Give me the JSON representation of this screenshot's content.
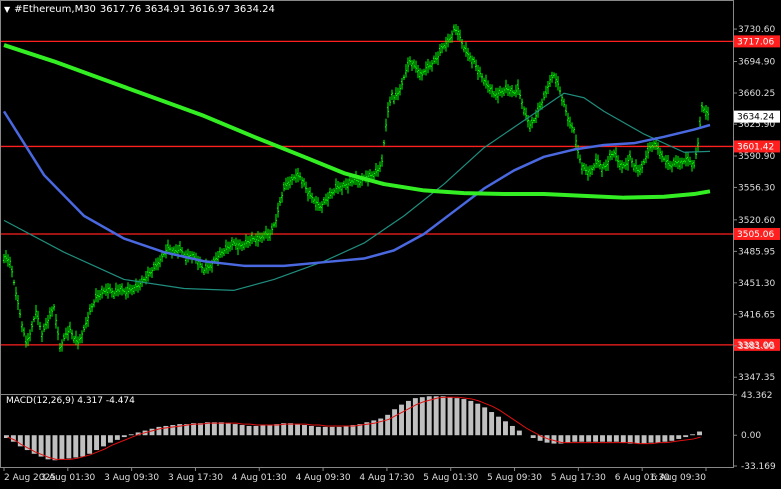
{
  "header": {
    "title": "#Ethereum,M30",
    "ohlc": "3617.76 3634.91 3616.97 3634.24"
  },
  "macd_header": {
    "label": "MACD(12,26,9)",
    "values": "4.317 -4.474"
  },
  "colors": {
    "background": "#000000",
    "candle": "#00ff00",
    "ma_fast": "#1f8e7e",
    "ma_mid": "#4a68e0",
    "ma_slow": "#33ee22",
    "hline": "#ff1f1f",
    "macd_hist": "#c0c0c0",
    "macd_signal": "#e01010",
    "price_tag_bg": "#ffffff",
    "price_tag_text": "#000000"
  },
  "chart_data": [
    {
      "type": "candlestick",
      "symbol": "#Ethereum",
      "timeframe": "M30",
      "ylim": [
        3330,
        3745
      ],
      "y_ticks": [
        "3730.60",
        "3694.90",
        "3660.25",
        "3625.90",
        "3590.90",
        "3556.30",
        "3520.60",
        "3485.95",
        "3451.30",
        "3416.65",
        "3381.95",
        "3347.35"
      ],
      "x_ticks": [
        "2 Aug 2025",
        "3 Aug 01:30",
        "3 Aug 09:30",
        "3 Aug 17:30",
        "4 Aug 01:30",
        "4 Aug 09:30",
        "4 Aug 17:30",
        "5 Aug 01:30",
        "5 Aug 09:30",
        "5 Aug 17:30",
        "6 Aug 01:30",
        "6 Aug 09:30"
      ],
      "horizontal_levels": [
        {
          "value": 3717.06,
          "label": "3717.06"
        },
        {
          "value": 3601.42,
          "label": "3601.42"
        },
        {
          "value": 3505.06,
          "label": "3505.06"
        },
        {
          "value": 3383.0,
          "label": "3383.00"
        }
      ],
      "current_price": {
        "value": 3634.24,
        "label": "3634.24"
      },
      "close_path": [
        [
          0,
          3480
        ],
        [
          6,
          3475
        ],
        [
          12,
          3440
        ],
        [
          18,
          3405
        ],
        [
          22,
          3385
        ],
        [
          26,
          3395
        ],
        [
          32,
          3420
        ],
        [
          38,
          3395
        ],
        [
          44,
          3410
        ],
        [
          50,
          3425
        ],
        [
          56,
          3380
        ],
        [
          62,
          3395
        ],
        [
          66,
          3400
        ],
        [
          70,
          3390
        ],
        [
          74,
          3385
        ],
        [
          80,
          3400
        ],
        [
          86,
          3420
        ],
        [
          92,
          3435
        ],
        [
          98,
          3440
        ],
        [
          104,
          3445
        ],
        [
          110,
          3440
        ],
        [
          116,
          3445
        ],
        [
          122,
          3440
        ],
        [
          128,
          3445
        ],
        [
          134,
          3448
        ],
        [
          140,
          3455
        ],
        [
          146,
          3462
        ],
        [
          152,
          3470
        ],
        [
          158,
          3480
        ],
        [
          164,
          3490
        ],
        [
          170,
          3485
        ],
        [
          176,
          3488
        ],
        [
          182,
          3480
        ],
        [
          188,
          3482
        ],
        [
          194,
          3475
        ],
        [
          200,
          3465
        ],
        [
          206,
          3470
        ],
        [
          212,
          3478
        ],
        [
          218,
          3485
        ],
        [
          224,
          3490
        ],
        [
          230,
          3495
        ],
        [
          236,
          3492
        ],
        [
          242,
          3495
        ],
        [
          248,
          3500
        ],
        [
          254,
          3498
        ],
        [
          260,
          3505
        ],
        [
          266,
          3505
        ],
        [
          272,
          3520
        ],
        [
          276,
          3540
        ],
        [
          280,
          3555
        ],
        [
          284,
          3562
        ],
        [
          288,
          3565
        ],
        [
          292,
          3570
        ],
        [
          296,
          3568
        ],
        [
          300,
          3560
        ],
        [
          304,
          3550
        ],
        [
          308,
          3545
        ],
        [
          312,
          3540
        ],
        [
          316,
          3535
        ],
        [
          320,
          3540
        ],
        [
          324,
          3545
        ],
        [
          328,
          3550
        ],
        [
          332,
          3555
        ],
        [
          338,
          3558
        ],
        [
          344,
          3560
        ],
        [
          350,
          3565
        ],
        [
          356,
          3562
        ],
        [
          362,
          3568
        ],
        [
          368,
          3570
        ],
        [
          374,
          3575
        ],
        [
          378,
          3585
        ],
        [
          380,
          3605
        ],
        [
          382,
          3625
        ],
        [
          384,
          3640
        ],
        [
          386,
          3650
        ],
        [
          388,
          3660
        ],
        [
          390,
          3655
        ],
        [
          394,
          3660
        ],
        [
          398,
          3670
        ],
        [
          402,
          3685
        ],
        [
          406,
          3695
        ],
        [
          410,
          3690
        ],
        [
          414,
          3685
        ],
        [
          418,
          3680
        ],
        [
          422,
          3688
        ],
        [
          426,
          3690
        ],
        [
          430,
          3695
        ],
        [
          434,
          3700
        ],
        [
          438,
          3710
        ],
        [
          442,
          3715
        ],
        [
          446,
          3720
        ],
        [
          450,
          3730
        ],
        [
          454,
          3728
        ],
        [
          458,
          3715
        ],
        [
          462,
          3705
        ],
        [
          466,
          3700
        ],
        [
          470,
          3695
        ],
        [
          474,
          3685
        ],
        [
          478,
          3678
        ],
        [
          482,
          3670
        ],
        [
          486,
          3665
        ],
        [
          490,
          3658
        ],
        [
          494,
          3660
        ],
        [
          498,
          3662
        ],
        [
          502,
          3665
        ],
        [
          506,
          3663
        ],
        [
          510,
          3660
        ],
        [
          514,
          3665
        ],
        [
          518,
          3650
        ],
        [
          522,
          3635
        ],
        [
          526,
          3625
        ],
        [
          530,
          3630
        ],
        [
          534,
          3640
        ],
        [
          538,
          3650
        ],
        [
          542,
          3660
        ],
        [
          546,
          3675
        ],
        [
          550,
          3680
        ],
        [
          554,
          3670
        ],
        [
          558,
          3655
        ],
        [
          562,
          3640
        ],
        [
          566,
          3625
        ],
        [
          570,
          3620
        ],
        [
          574,
          3595
        ],
        [
          578,
          3580
        ],
        [
          582,
          3575
        ],
        [
          586,
          3572
        ],
        [
          590,
          3580
        ],
        [
          594,
          3585
        ],
        [
          598,
          3578
        ],
        [
          602,
          3580
        ],
        [
          606,
          3590
        ],
        [
          610,
          3595
        ],
        [
          614,
          3585
        ],
        [
          618,
          3578
        ],
        [
          622,
          3582
        ],
        [
          626,
          3590
        ],
        [
          630,
          3580
        ],
        [
          634,
          3575
        ],
        [
          638,
          3578
        ],
        [
          642,
          3590
        ],
        [
          646,
          3600
        ],
        [
          650,
          3605
        ],
        [
          654,
          3600
        ],
        [
          658,
          3590
        ],
        [
          662,
          3585
        ],
        [
          666,
          3580
        ],
        [
          670,
          3582
        ],
        [
          674,
          3585
        ],
        [
          678,
          3583
        ],
        [
          682,
          3588
        ],
        [
          686,
          3585
        ],
        [
          690,
          3580
        ],
        [
          694,
          3605
        ],
        [
          698,
          3645
        ],
        [
          702,
          3640
        ],
        [
          706,
          3634
        ]
      ],
      "series": [
        {
          "name": "",
          "style": "ma_fast",
          "points": [
            [
              0,
              3520
            ],
            [
              60,
              3485
            ],
            [
              120,
              3455
            ],
            [
              180,
              3445
            ],
            [
              230,
              3443
            ],
            [
              270,
              3455
            ],
            [
              320,
              3475
            ],
            [
              360,
              3495
            ],
            [
              400,
              3525
            ],
            [
              440,
              3560
            ],
            [
              480,
              3600
            ],
            [
              520,
              3630
            ],
            [
              560,
              3660
            ],
            [
              580,
              3655
            ],
            [
              600,
              3640
            ],
            [
              640,
              3615
            ],
            [
              680,
              3595
            ],
            [
              706,
              3596
            ]
          ]
        },
        {
          "name": "",
          "style": "ma_mid",
          "points": [
            [
              0,
              3640
            ],
            [
              40,
              3570
            ],
            [
              80,
              3525
            ],
            [
              120,
              3500
            ],
            [
              160,
              3485
            ],
            [
              200,
              3475
            ],
            [
              240,
              3470
            ],
            [
              280,
              3470
            ],
            [
              320,
              3474
            ],
            [
              360,
              3478
            ],
            [
              390,
              3487
            ],
            [
              420,
              3505
            ],
            [
              450,
              3530
            ],
            [
              480,
              3555
            ],
            [
              510,
              3575
            ],
            [
              540,
              3590
            ],
            [
              570,
              3598
            ],
            [
              600,
              3603
            ],
            [
              630,
              3605
            ],
            [
              660,
              3612
            ],
            [
              690,
              3620
            ],
            [
              706,
              3625
            ]
          ]
        },
        {
          "name": "",
          "style": "ma_slow",
          "points": [
            [
              0,
              3713
            ],
            [
              50,
              3695
            ],
            [
              100,
              3675
            ],
            [
              150,
              3655
            ],
            [
              200,
              3635
            ],
            [
              250,
              3612
            ],
            [
              300,
              3590
            ],
            [
              340,
              3572
            ],
            [
              380,
              3560
            ],
            [
              420,
              3553
            ],
            [
              460,
              3550
            ],
            [
              500,
              3549
            ],
            [
              540,
              3549
            ],
            [
              580,
              3547
            ],
            [
              620,
              3545
            ],
            [
              660,
              3546
            ],
            [
              690,
              3549
            ],
            [
              706,
              3552
            ]
          ]
        }
      ]
    },
    {
      "type": "bar",
      "name": "MACD(12,26,9)",
      "ylim": [
        -33.169,
        43.362
      ],
      "y_ticks": [
        "43.362",
        "0.00",
        "-33.169"
      ],
      "values": [
        -3,
        -7,
        -12,
        -16,
        -20,
        -23,
        -26,
        -27,
        -26,
        -25,
        -24,
        -23,
        -20,
        -16,
        -12,
        -8,
        -5,
        -2,
        1,
        3,
        5,
        7,
        9,
        10,
        11,
        12,
        12,
        13,
        13,
        14,
        14,
        14,
        13,
        12,
        11,
        10,
        10,
        11,
        11,
        12,
        13,
        13,
        12,
        11,
        10,
        9,
        9,
        9,
        9,
        10,
        11,
        12,
        14,
        16,
        18,
        22,
        28,
        33,
        37,
        40,
        41,
        42,
        42,
        42,
        41,
        40,
        39,
        37,
        34,
        30,
        25,
        20,
        15,
        10,
        5,
        0,
        -3,
        -6,
        -8,
        -9,
        -9,
        -8,
        -7,
        -7,
        -7,
        -7,
        -7,
        -7,
        -7,
        -8,
        -9,
        -9,
        -9,
        -8,
        -8,
        -7,
        -6,
        -4,
        -2,
        1,
        4
      ],
      "signal": [
        -2,
        -5,
        -10,
        -14,
        -18,
        -21,
        -24,
        -26,
        -26,
        -26,
        -25,
        -23,
        -21,
        -18,
        -15,
        -11,
        -8,
        -5,
        -2,
        1,
        3,
        5,
        7,
        8,
        9,
        10,
        11,
        12,
        12,
        13,
        13,
        13,
        13,
        13,
        12,
        12,
        11,
        11,
        11,
        11,
        12,
        12,
        12,
        12,
        11,
        11,
        10,
        10,
        10,
        10,
        10,
        11,
        12,
        13,
        15,
        17,
        21,
        25,
        29,
        33,
        36,
        38,
        40,
        41,
        41,
        41,
        40,
        39,
        37,
        34,
        31,
        27,
        22,
        17,
        12,
        7,
        3,
        -1,
        -4,
        -6,
        -8,
        -8,
        -8,
        -8,
        -8,
        -8,
        -8,
        -8,
        -8,
        -8,
        -8,
        -9,
        -9,
        -9,
        -8,
        -8,
        -7,
        -6,
        -5,
        -4,
        -2
      ]
    }
  ]
}
